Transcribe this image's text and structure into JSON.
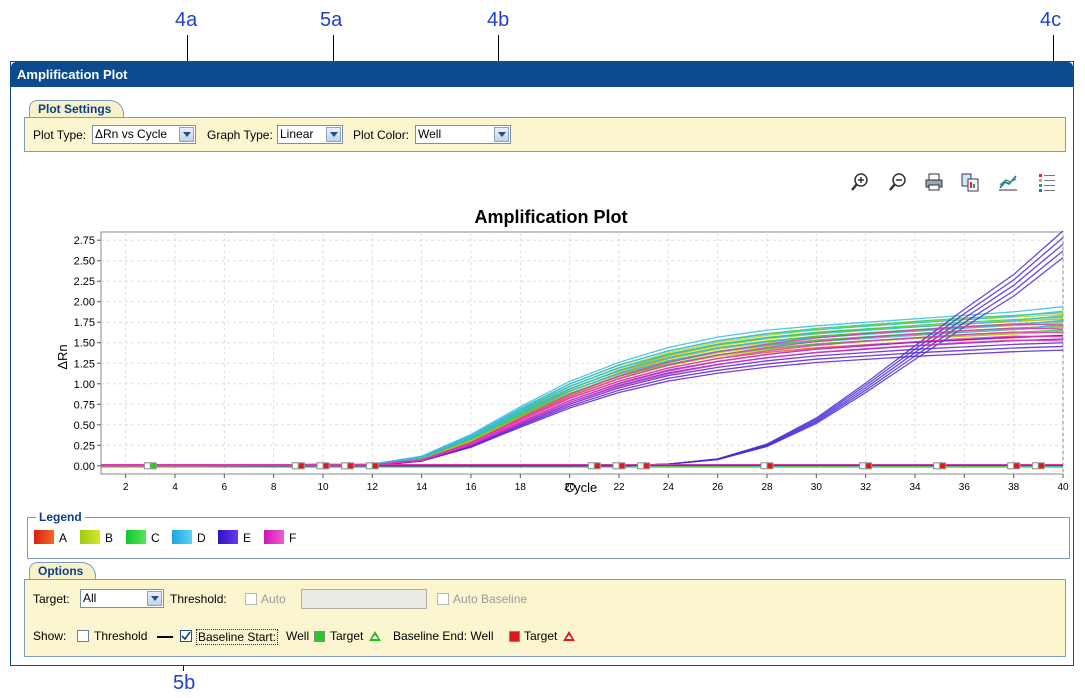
{
  "callouts": {
    "a4a": "4a",
    "a5a": "5a",
    "a4b": "4b",
    "a4c": "4c",
    "a5b": "5b"
  },
  "panel": {
    "title": "Amplification Plot"
  },
  "plot_settings": {
    "tab_label": "Plot Settings",
    "plot_type_label": "Plot Type:",
    "plot_type_value": "ΔRn vs Cycle",
    "graph_type_label": "Graph Type:",
    "graph_type_value": "Linear",
    "plot_color_label": "Plot Color:",
    "plot_color_value": "Well"
  },
  "toolbar": {
    "icons": [
      "zoom-in-icon",
      "zoom-out-icon",
      "print-icon",
      "copy-to-clipboard-icon",
      "save-plot-icon",
      "legend-icon"
    ]
  },
  "chart_data": {
    "type": "line",
    "title": "Amplification Plot",
    "xlabel": "Cycle",
    "ylabel": "ΔRn",
    "xlim": [
      1,
      40
    ],
    "ylim": [
      -0.1,
      2.85
    ],
    "x_ticks": [
      "2",
      "4",
      "6",
      "8",
      "10",
      "12",
      "14",
      "16",
      "18",
      "20",
      "22",
      "24",
      "26",
      "28",
      "30",
      "32",
      "34",
      "36",
      "38",
      "40"
    ],
    "y_ticks": [
      "0.00",
      "0.25",
      "0.50",
      "0.75",
      "1.00",
      "1.25",
      "1.50",
      "1.75",
      "2.00",
      "2.25",
      "2.50",
      "2.75"
    ],
    "grid": true,
    "series": [
      {
        "name": "A",
        "color": "#e8561c",
        "values": [
          [
            1,
            0
          ],
          [
            12,
            0.01
          ],
          [
            14,
            0.08
          ],
          [
            16,
            0.3
          ],
          [
            18,
            0.6
          ],
          [
            20,
            0.88
          ],
          [
            22,
            1.1
          ],
          [
            24,
            1.27
          ],
          [
            26,
            1.39
          ],
          [
            28,
            1.47
          ],
          [
            30,
            1.53
          ],
          [
            32,
            1.57
          ],
          [
            34,
            1.6
          ],
          [
            36,
            1.63
          ],
          [
            38,
            1.66
          ],
          [
            40,
            1.69
          ]
        ]
      },
      {
        "name": "B",
        "color": "#b6d61b",
        "values": [
          [
            1,
            0
          ],
          [
            12,
            0.01
          ],
          [
            14,
            0.09
          ],
          [
            16,
            0.32
          ],
          [
            18,
            0.63
          ],
          [
            20,
            0.91
          ],
          [
            22,
            1.13
          ],
          [
            24,
            1.3
          ],
          [
            26,
            1.42
          ],
          [
            28,
            1.5
          ],
          [
            30,
            1.56
          ],
          [
            32,
            1.61
          ],
          [
            34,
            1.65
          ],
          [
            36,
            1.68
          ],
          [
            38,
            1.71
          ],
          [
            40,
            1.74
          ]
        ]
      },
      {
        "name": "C",
        "color": "#2fd13a",
        "values": [
          [
            1,
            0
          ],
          [
            12,
            0.02
          ],
          [
            14,
            0.1
          ],
          [
            16,
            0.34
          ],
          [
            18,
            0.65
          ],
          [
            20,
            0.94
          ],
          [
            22,
            1.16
          ],
          [
            24,
            1.32
          ],
          [
            26,
            1.44
          ],
          [
            28,
            1.52
          ],
          [
            30,
            1.58
          ],
          [
            32,
            1.62
          ],
          [
            34,
            1.66
          ],
          [
            36,
            1.7
          ],
          [
            38,
            1.73
          ],
          [
            40,
            1.76
          ]
        ]
      },
      {
        "name": "D",
        "color": "#38b8e6",
        "values": [
          [
            1,
            0
          ],
          [
            12,
            0.02
          ],
          [
            14,
            0.11
          ],
          [
            16,
            0.36
          ],
          [
            18,
            0.68
          ],
          [
            20,
            0.97
          ],
          [
            22,
            1.19
          ],
          [
            24,
            1.36
          ],
          [
            26,
            1.48
          ],
          [
            28,
            1.56
          ],
          [
            30,
            1.61
          ],
          [
            32,
            1.65
          ],
          [
            34,
            1.69
          ],
          [
            36,
            1.73
          ],
          [
            38,
            1.77
          ],
          [
            40,
            1.83
          ]
        ]
      },
      {
        "name": "E",
        "color": "#5a1fd6",
        "values": [
          [
            1,
            0
          ],
          [
            12,
            0
          ],
          [
            14,
            0.06
          ],
          [
            16,
            0.24
          ],
          [
            18,
            0.5
          ],
          [
            20,
            0.75
          ],
          [
            22,
            0.95
          ],
          [
            24,
            1.1
          ],
          [
            26,
            1.2
          ],
          [
            28,
            1.28
          ],
          [
            30,
            1.34
          ],
          [
            32,
            1.38
          ],
          [
            34,
            1.42
          ],
          [
            36,
            1.45
          ],
          [
            38,
            1.48
          ],
          [
            40,
            1.5
          ]
        ]
      },
      {
        "name": "E",
        "color": "#4a2ad8",
        "values": [
          [
            1,
            0
          ],
          [
            22,
            0
          ],
          [
            24,
            0.02
          ],
          [
            26,
            0.08
          ],
          [
            28,
            0.25
          ],
          [
            30,
            0.55
          ],
          [
            32,
            0.95
          ],
          [
            34,
            1.38
          ],
          [
            36,
            1.8
          ],
          [
            38,
            2.2
          ],
          [
            40,
            2.7
          ]
        ]
      },
      {
        "name": "F",
        "color": "#e233b8",
        "values": [
          [
            1,
            0
          ],
          [
            12,
            0.01
          ],
          [
            14,
            0.07
          ],
          [
            16,
            0.27
          ],
          [
            18,
            0.55
          ],
          [
            20,
            0.82
          ],
          [
            22,
            1.03
          ],
          [
            24,
            1.19
          ],
          [
            26,
            1.31
          ],
          [
            28,
            1.4
          ],
          [
            30,
            1.47
          ],
          [
            32,
            1.52
          ],
          [
            34,
            1.56
          ],
          [
            36,
            1.6
          ],
          [
            38,
            1.63
          ],
          [
            40,
            1.62
          ]
        ]
      }
    ],
    "baseline_markers": [
      {
        "cycle": 3,
        "kind": "start"
      },
      {
        "cycle": 9,
        "kind": "end"
      },
      {
        "cycle": 10,
        "kind": "end"
      },
      {
        "cycle": 11,
        "kind": "end"
      },
      {
        "cycle": 12,
        "kind": "end"
      },
      {
        "cycle": 21,
        "kind": "end"
      },
      {
        "cycle": 22,
        "kind": "end"
      },
      {
        "cycle": 23,
        "kind": "end"
      },
      {
        "cycle": 28,
        "kind": "end"
      },
      {
        "cycle": 32,
        "kind": "end"
      },
      {
        "cycle": 35,
        "kind": "end"
      },
      {
        "cycle": 38,
        "kind": "end"
      },
      {
        "cycle": 39,
        "kind": "end"
      }
    ]
  },
  "legend": {
    "title": "Legend",
    "items": [
      {
        "label": "A",
        "c1": "#d8200e",
        "c2": "#f46a2a"
      },
      {
        "label": "B",
        "c1": "#9ccc12",
        "c2": "#d8e62c"
      },
      {
        "label": "C",
        "c1": "#12c82c",
        "c2": "#5be25e"
      },
      {
        "label": "D",
        "c1": "#1aa4e6",
        "c2": "#5fd2f0"
      },
      {
        "label": "E",
        "c1": "#2a14c8",
        "c2": "#6a3ae6"
      },
      {
        "label": "F",
        "c1": "#d014b8",
        "c2": "#f05ccf"
      }
    ]
  },
  "options": {
    "tab_label": "Options",
    "target_label": "Target:",
    "target_value": "All",
    "threshold_label": "Threshold:",
    "auto_label": "Auto",
    "auto_baseline_label": "Auto Baseline",
    "show_label": "Show:",
    "threshold_show_label": "Threshold",
    "baseline_start_label": "Baseline Start:",
    "well_label": "Well",
    "target_label2": "Target",
    "baseline_end_label": "Baseline End: Well",
    "target_label3": "Target"
  }
}
